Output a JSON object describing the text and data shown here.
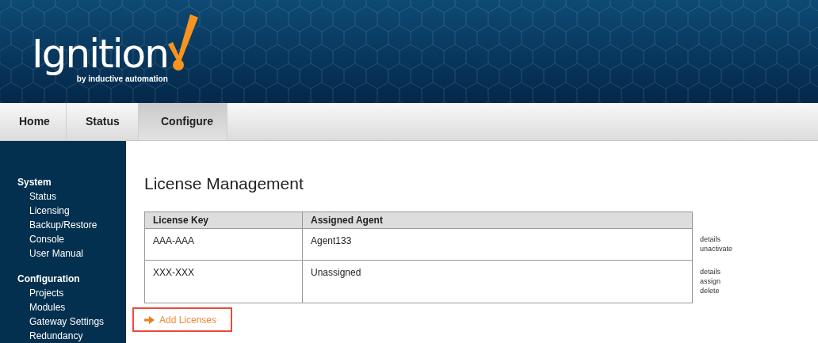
{
  "logo": {
    "name": "Ignition",
    "tagline": "by inductive automation"
  },
  "tabs": [
    {
      "label": "Home",
      "selected": false
    },
    {
      "label": "Status",
      "selected": false
    },
    {
      "label": "Configure",
      "selected": true
    }
  ],
  "sidebar": {
    "sections": [
      {
        "title": "System",
        "items": [
          "Status",
          "Licensing",
          "Backup/Restore",
          "Console",
          "User Manual"
        ]
      },
      {
        "title": "Configuration",
        "items": [
          "Projects",
          "Modules",
          "Gateway Settings",
          "Redundancy"
        ]
      }
    ]
  },
  "page_title": "License Management",
  "table": {
    "columns": [
      "License Key",
      "Assigned Agent"
    ],
    "rows": [
      {
        "license_key": "AAA-AAA",
        "assigned_agent": "Agent133",
        "actions": [
          "details",
          "unactivate"
        ]
      },
      {
        "license_key": "XXX-XXX",
        "assigned_agent": "Unassigned",
        "actions": [
          "details",
          "assign",
          "delete"
        ]
      }
    ]
  },
  "add_link": {
    "label": "Add Licenses"
  }
}
